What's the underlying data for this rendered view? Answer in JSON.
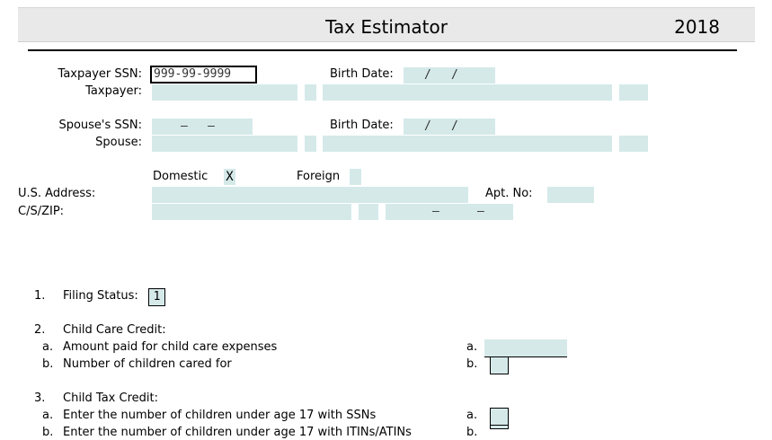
{
  "header": {
    "title": "Tax Estimator",
    "year": "2018"
  },
  "taxpayer": {
    "ssn_label": "Taxpayer SSN:",
    "ssn_value": "999-99-9999",
    "birth_label": "Birth Date:",
    "name_label": "Taxpayer:"
  },
  "spouse": {
    "ssn_label": "Spouse's SSN:",
    "birth_label": "Birth Date:",
    "name_label": "Spouse:"
  },
  "address": {
    "domestic_label": "Domestic",
    "domestic_mark": "X",
    "foreign_label": "Foreign",
    "us_address_label": "U.S. Address:",
    "apt_label": "Apt. No:",
    "csz_label": "C/S/ZIP:"
  },
  "separators": {
    "date": "/",
    "dash": "–"
  },
  "line1": {
    "num": "1.",
    "label": "Filing Status:",
    "value": "1"
  },
  "line2": {
    "num": "2.",
    "label": "Child Care Credit:",
    "a_letter": "a.",
    "a_label": "Amount paid for child care expenses",
    "a_ref": "a.",
    "b_letter": "b.",
    "b_label": "Number of children cared for",
    "b_ref": "b."
  },
  "line3": {
    "num": "3.",
    "label": "Child Tax Credit:",
    "a_letter": "a.",
    "a_label": "Enter the number of children under age 17 with SSNs",
    "a_ref": "a.",
    "b_letter": "b.",
    "b_label": "Enter the number of children under age 17 with ITINs/ATINs",
    "b_ref": "b."
  }
}
